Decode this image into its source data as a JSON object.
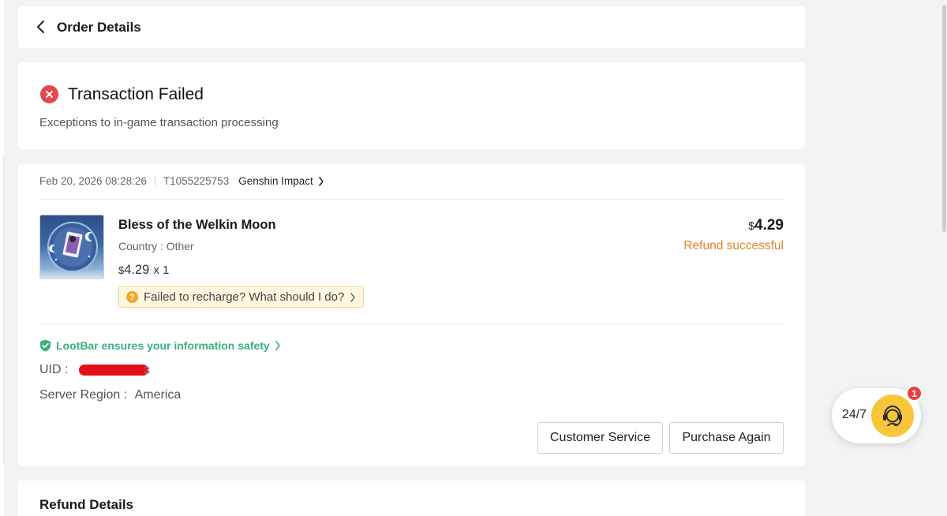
{
  "header": {
    "title": "Order Details"
  },
  "status": {
    "icon": "close-circle-icon",
    "title": "Transaction Failed",
    "description": "Exceptions to in-game transaction processing",
    "color": "#e5474d"
  },
  "order": {
    "date": "Feb 20, 2026 08:28:26",
    "order_id": "T1055225753",
    "game": "Genshin Impact",
    "product": {
      "name": "Bless of the Welkin Moon",
      "country_label": "Country :",
      "country": "Other",
      "currency_symbol": "$",
      "price": "4.29",
      "quantity": "x 1",
      "image_icon": "welkin-moon-image"
    },
    "help_tip": "Failed to recharge? What should I do?",
    "total": {
      "currency_symbol": "$",
      "amount": "4.29"
    },
    "refund_status": "Refund successful",
    "refund_color": "#e2832a",
    "safety_text": "LootBar ensures your information safety",
    "safety_color": "#3ab07b",
    "uid_label": "UID :",
    "uid_tail": "3",
    "server_label": "Server Region :",
    "server_value": "America",
    "buttons": {
      "customer_service": "Customer Service",
      "purchase_again": "Purchase Again"
    }
  },
  "refund": {
    "title": "Refund Details"
  },
  "support": {
    "label": "24/7",
    "badge": "1",
    "icon": "headset-agent-icon",
    "accent": "#f7c63b"
  }
}
